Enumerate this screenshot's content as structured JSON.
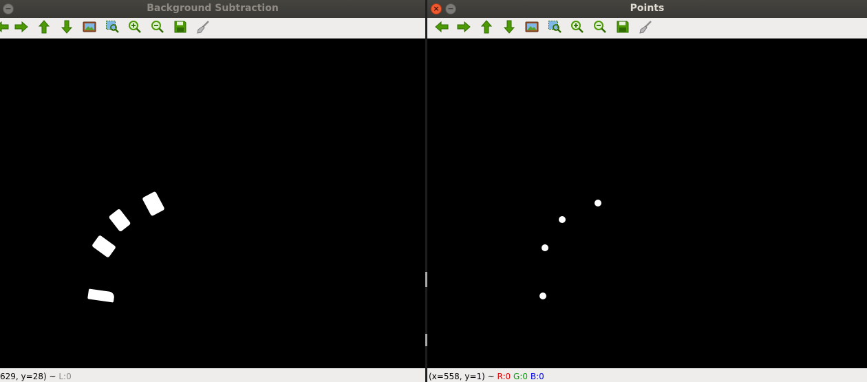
{
  "windows": [
    {
      "title": "Background Subtraction",
      "status": {
        "coords": "629, y=28) ~",
        "values": [
          {
            "label": "L:0",
            "color": "#8a8a8a"
          }
        ]
      }
    },
    {
      "title": "Points",
      "status": {
        "coords": "(x=558, y=1) ~",
        "values": [
          {
            "label": "R:0",
            "color": "#e00000"
          },
          {
            "label": "G:0",
            "color": "#00a000"
          },
          {
            "label": "B:0",
            "color": "#0000e0"
          }
        ]
      }
    }
  ],
  "toolbar_icons": [
    "arrow-left-icon",
    "arrow-right-icon",
    "arrow-up-icon",
    "arrow-down-icon",
    "image-icon",
    "zoom-region-icon",
    "zoom-in-icon",
    "zoom-out-icon",
    "save-icon",
    "brush-icon"
  ],
  "colors": {
    "icon_green": "#4e9a06",
    "icon_green_dark": "#2f6b00",
    "image_bg": "#000000",
    "foreground": "#ffffff"
  }
}
